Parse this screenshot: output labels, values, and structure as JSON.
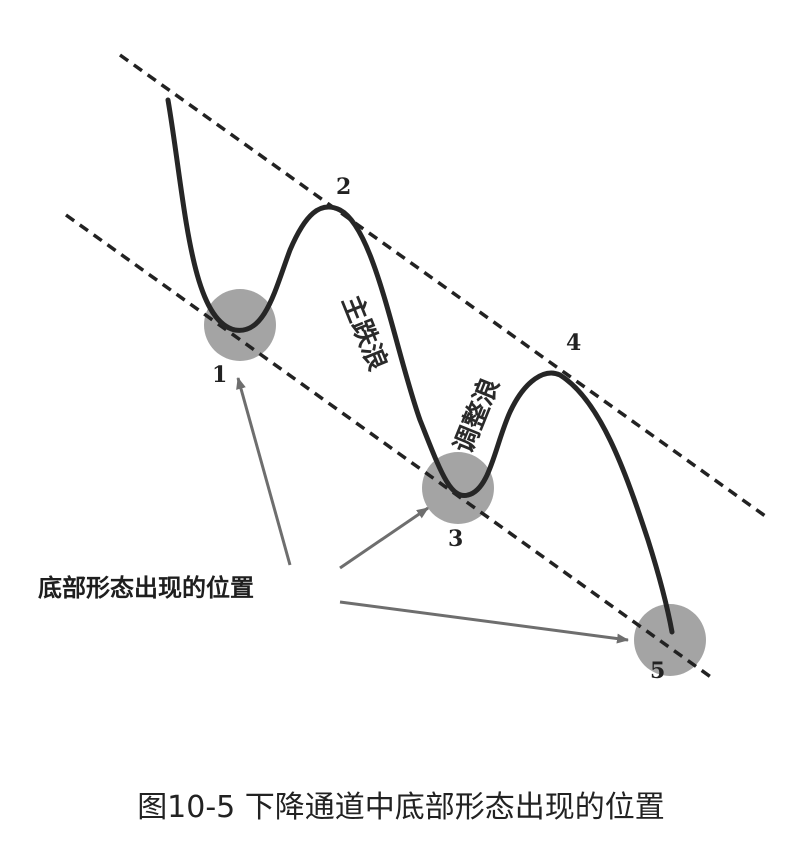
{
  "labels": {
    "point_1": "1",
    "point_2": "2",
    "point_3": "3",
    "point_4": "4",
    "point_5": "5",
    "main_wave": "主跌浪",
    "adjust_wave": "调整浪",
    "annotation": "底部形态出现的位置"
  },
  "caption": "图10-5 下降通道中底部形态出现的位置",
  "colors": {
    "line": "#222222",
    "circle": "#9a9a9a",
    "arrow": "#6e6e6e"
  }
}
